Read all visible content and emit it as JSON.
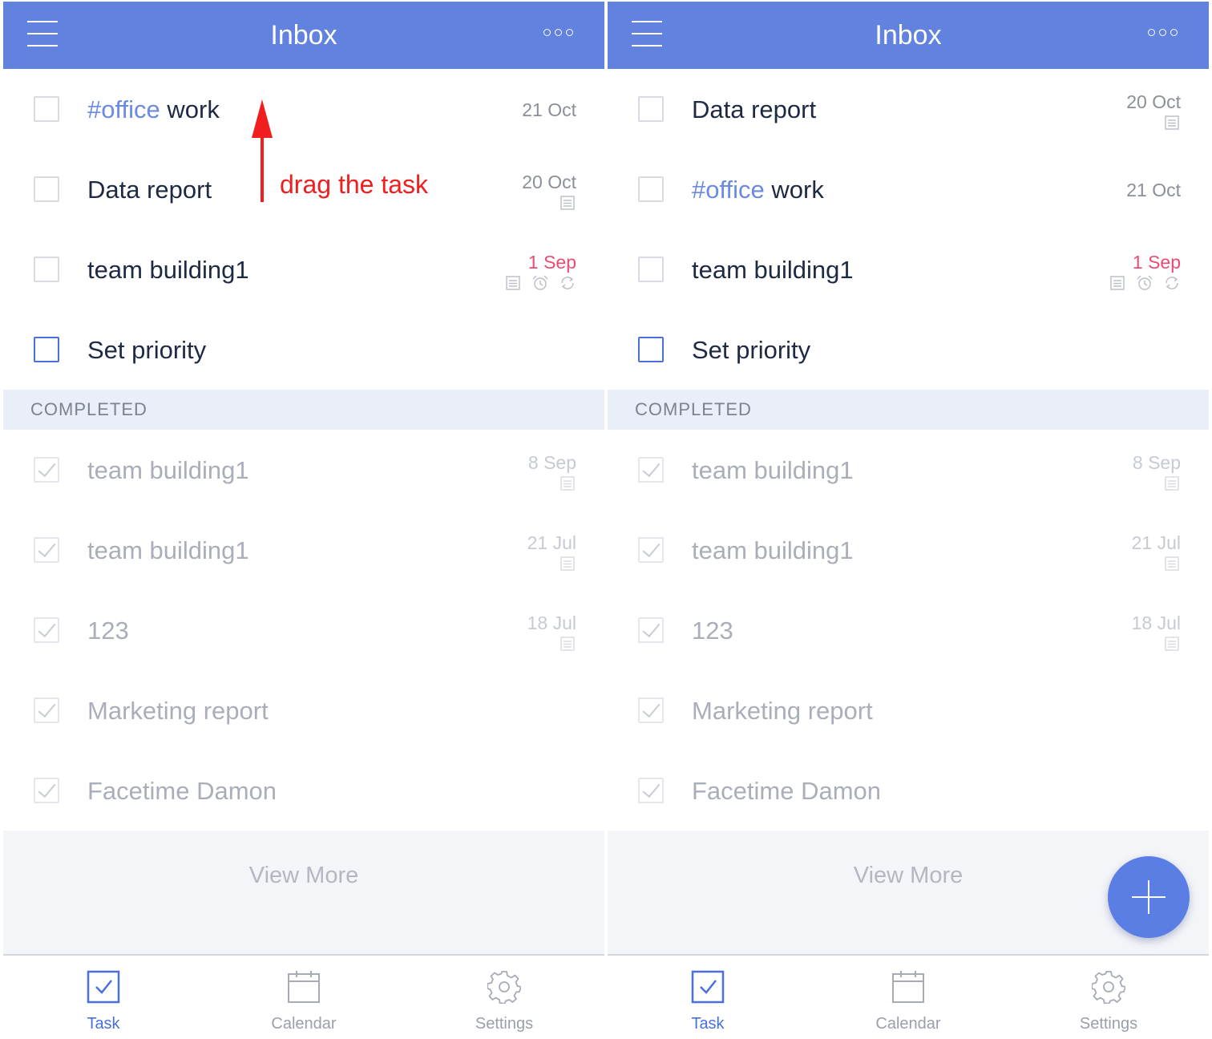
{
  "colors": {
    "header": "#6282e0",
    "accent": "#4a6fe0",
    "overdue": "#f04a73",
    "tag": "#6b8ae4",
    "annotation": "#f01e1e"
  },
  "left": {
    "header": {
      "title": "Inbox"
    },
    "tasks": [
      {
        "tag": "#office",
        "title": " work",
        "date": "21 Oct",
        "icons": []
      },
      {
        "title": "Data report",
        "date": "20 Oct",
        "icons": [
          "note-icon"
        ]
      },
      {
        "title": "team building1",
        "date": "1 Sep",
        "overdue": true,
        "icons": [
          "note-icon",
          "alarm-icon",
          "repeat-icon"
        ]
      },
      {
        "title": "Set priority",
        "date": "",
        "icons": []
      }
    ],
    "completed_label": "COMPLETED",
    "completed": [
      {
        "title": "team building1",
        "date": "8 Sep"
      },
      {
        "title": "team building1",
        "date": "21 Jul"
      },
      {
        "title": "123",
        "date": "18 Jul"
      },
      {
        "title": "Marketing report",
        "date": ""
      },
      {
        "title": "Facetime Damon",
        "date": ""
      }
    ],
    "view_more": "View More",
    "annotation": "drag the task"
  },
  "right": {
    "header": {
      "title": "Inbox"
    },
    "tasks": [
      {
        "title": "Data report",
        "date": "20 Oct",
        "icons": [
          "note-icon"
        ]
      },
      {
        "tag": "#office",
        "title": " work",
        "date": "21 Oct",
        "icons": []
      },
      {
        "title": "team building1",
        "date": "1 Sep",
        "overdue": true,
        "icons": [
          "note-icon",
          "alarm-icon",
          "repeat-icon"
        ]
      },
      {
        "title": "Set priority",
        "date": "",
        "icons": []
      }
    ],
    "completed_label": "COMPLETED",
    "completed": [
      {
        "title": "team building1",
        "date": "8 Sep"
      },
      {
        "title": "team building1",
        "date": "21 Jul"
      },
      {
        "title": "123",
        "date": "18 Jul"
      },
      {
        "title": "Marketing report",
        "date": ""
      },
      {
        "title": "Facetime Damon",
        "date": ""
      }
    ],
    "view_more": "View More"
  },
  "tabbar": {
    "task": "Task",
    "calendar": "Calendar",
    "settings": "Settings"
  }
}
